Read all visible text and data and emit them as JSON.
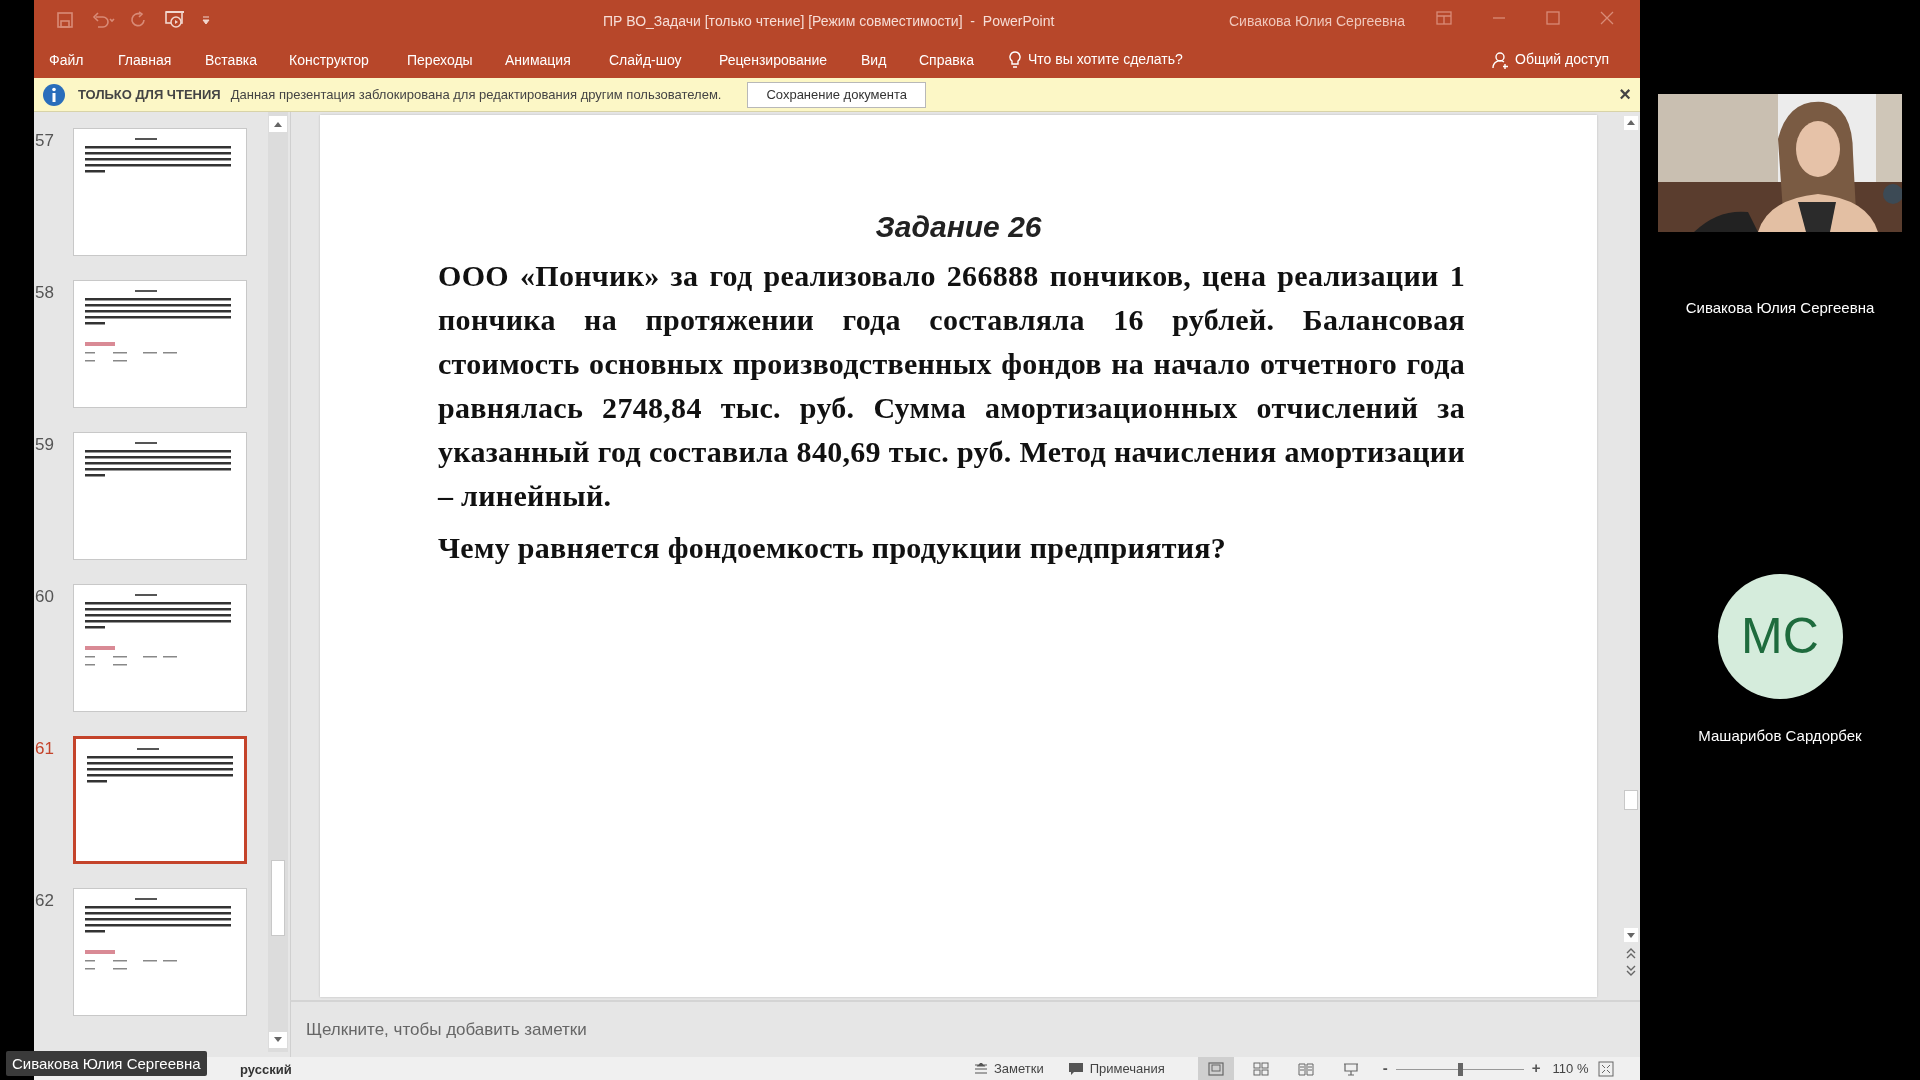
{
  "window": {
    "title": "ПР ВО_Задачи [только чтение] [Режим совместимости]  -  PowerPoint",
    "user": "Сивакова Юлия Сергеевна"
  },
  "ribbon": {
    "tabs": [
      "Файл",
      "Главная",
      "Вставка",
      "Конструктор",
      "Переходы",
      "Анимация",
      "Слайд-шоу",
      "Рецензирование",
      "Вид",
      "Справка"
    ],
    "tell_me": "Что вы хотите сделать?",
    "share": "Общий доступ"
  },
  "info_bar": {
    "label": "ТОЛЬКО ДЛЯ ЧТЕНИЯ",
    "message": "Данная презентация заблокирована для редактирования другим пользователем.",
    "button": "Сохранение документа",
    "close": "×"
  },
  "thumbnails": [
    {
      "number": "57",
      "selected": false,
      "kind": "text"
    },
    {
      "number": "58",
      "selected": false,
      "kind": "text_table"
    },
    {
      "number": "59",
      "selected": false,
      "kind": "text"
    },
    {
      "number": "60",
      "selected": false,
      "kind": "text_table"
    },
    {
      "number": "61",
      "selected": true,
      "kind": "text"
    },
    {
      "number": "62",
      "selected": false,
      "kind": "text_table"
    }
  ],
  "slide": {
    "title": "Задание 26",
    "body": "ООО «Пончик» за год реализовало 266888 пончиков, цена реализации 1 пончика на протяжении года составляла 16 рублей. Балансовая стоимость основных производственных фондов на начало отчетного года равнялась 2748,84 тыс. руб. Сумма амортизационных отчислений за указанный год составила 840,69 тыс. руб. Метод начисления амортизации – линейный.",
    "question": "Чему равняется фондоемкость продукции предприятия?"
  },
  "notes": {
    "placeholder": "Щелкните, чтобы добавить заметки"
  },
  "status_bar": {
    "language": "русский",
    "notes": "Заметки",
    "comments": "Примечания",
    "views": [
      {
        "kind": "normal",
        "selected": true
      },
      {
        "kind": "sorter",
        "selected": false
      },
      {
        "kind": "reading",
        "selected": false
      },
      {
        "kind": "slideshow",
        "selected": false
      }
    ],
    "zoom_minus": "-",
    "zoom_plus": "+",
    "zoom": {
      "level": 0.5
    },
    "zoom_value": "110 %"
  },
  "call": {
    "presenter_label": "Сивакова Юлия Сергеевна",
    "participants": [
      {
        "name": "Сивакова Юлия Сергеевна",
        "kind": "video"
      },
      {
        "name": "Машарибов Сардорбек",
        "kind": "avatar",
        "initials": "МС"
      }
    ]
  }
}
